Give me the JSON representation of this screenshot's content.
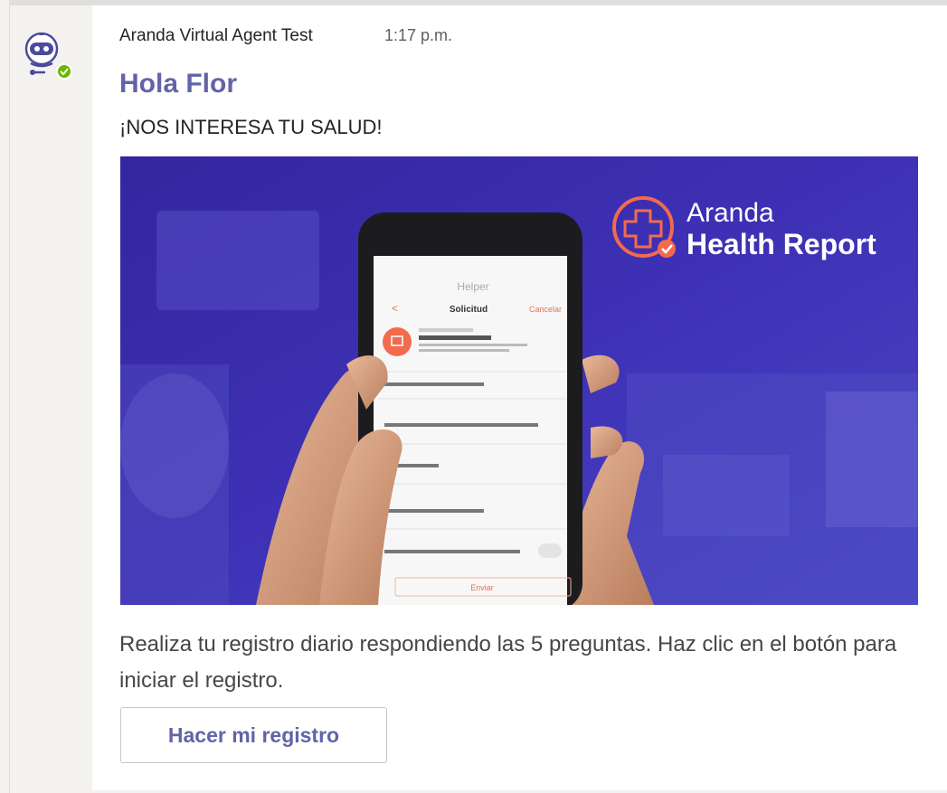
{
  "message": {
    "sender": "Aranda Virtual Agent Test",
    "time": "1:17 p.m.",
    "title": "Hola Flor",
    "subtitle": "¡NOS INTERESA TU SALUD!",
    "body": "Realiza tu registro diario respondiendo las 5 preguntas. Haz clic en el botón para iniciar el registro.",
    "button_label": "Hacer mi registro"
  },
  "hero": {
    "brand_line1": "Aranda",
    "brand_line2": "Health Report",
    "app_name": "Helper",
    "screen_title": "Solicitud",
    "screen_action": "Cancelar",
    "submit_label": "Enviar"
  },
  "icons": {
    "avatar": "bot-avatar-icon",
    "status": "online-check-icon",
    "brand_logo": "medical-cross-icon"
  },
  "colors": {
    "accent": "#6264a7",
    "status_green": "#6bb700",
    "hero_bg": "#3b2db0",
    "brand_orange": "#f26b4e"
  }
}
